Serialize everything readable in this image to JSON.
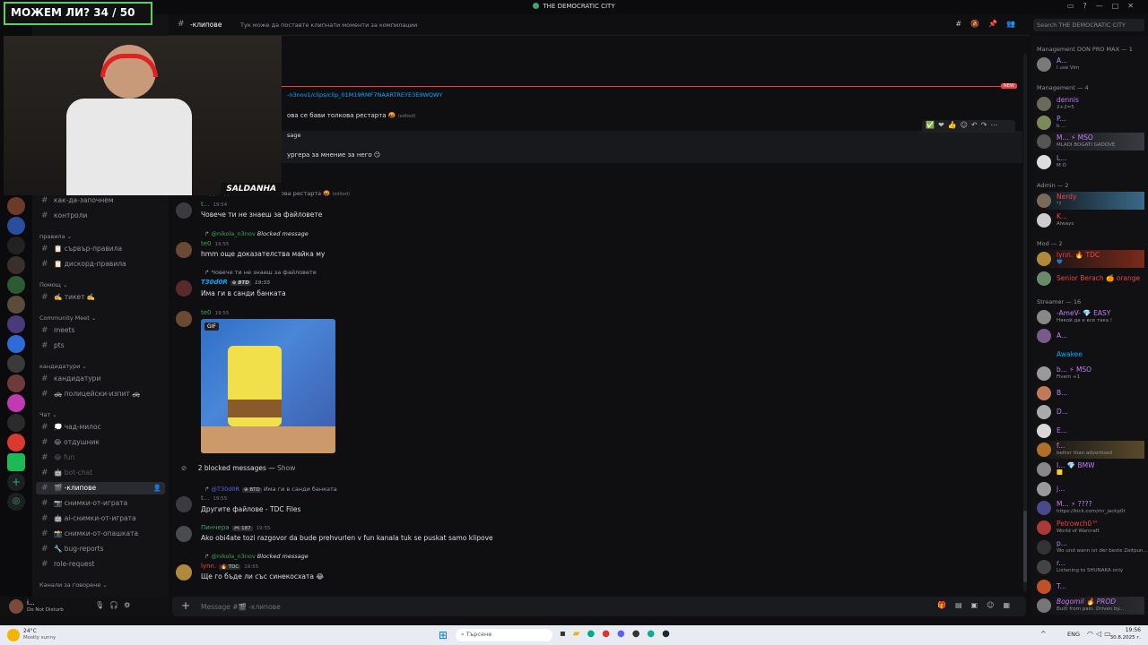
{
  "window": {
    "title": "THE DEMOCRATIC CITY",
    "controls": [
      "▭",
      "?",
      "—",
      "□",
      "✕"
    ]
  },
  "overlay": {
    "counter_text": "МОЖЕМ ЛИ? 34 / 50",
    "streamer_name": "SALDANHA"
  },
  "channel_header": {
    "name": "-клипове",
    "topic": "Тук може да поставте клипнати моменти за компилации",
    "search_placeholder": "Search THE DEMOCRATIC CITY"
  },
  "sidebar": {
    "channels_top": [
      "как-да-започнем",
      "контроли"
    ],
    "categories": [
      {
        "name": "правила",
        "channels": [
          "📋 сървър-правила",
          "📋 дискорд-правила"
        ]
      },
      {
        "name": "Помощ",
        "channels": [
          "✍️ тикет ✍️"
        ]
      },
      {
        "name": "Community Meet",
        "channels": [
          "meets",
          "pts"
        ]
      },
      {
        "name": "кандидатури",
        "channels": [
          "кандидатури",
          "🚓 полицейски-изпит 🚓"
        ]
      },
      {
        "name": "Чат",
        "channels": [
          "💭 чад-милос",
          "😂 отдушник",
          "😂 fun",
          "🤖 bot-chat",
          "🎬 -клипове",
          "📷 снимки-от-играта",
          "🤖 ai-снимки-от-играта",
          "📸 снимки-от-опашката",
          "🔧 bug-reports",
          "role-request"
        ]
      },
      {
        "name": "Канали за говорене",
        "channels": []
      }
    ],
    "active_channel": "🎬 -клипове",
    "muted_channels": [
      "😂 fun",
      "🤖 bot-chat"
    ]
  },
  "user_panel": {
    "name": "i...",
    "status": "Do Not Disturb"
  },
  "messages": {
    "top_partial": [
      {
        "text": "-n3nov1/clips/clip_01M19RMF7NAARTREYE3E9WQWY"
      },
      {
        "text": "ова се бави толкова рестарта 🤬",
        "edited": "(edited)"
      },
      {
        "text": "sage"
      },
      {
        "text": "ургера за мнение за него 😏"
      }
    ],
    "new_label": "NEW",
    "list": [
      {
        "reply": "...дизадали се бави толкова рестарта 🤬",
        "reply_edited": "(edited)",
        "author": "t...",
        "time": "19:54",
        "text": "Човече ти не знаеш за файловете",
        "color": "#3ba55c"
      },
      {
        "reply_user": "@nikola_n3nov",
        "reply_text": "Blocked message",
        "author": "te0",
        "time": "19:55",
        "text": "hmm още доказателства майка му",
        "color": "#3ba55c"
      },
      {
        "reply": "Човече ти не знаеш за файловете",
        "author": "T30d0R",
        "badge": "⊕ BTD",
        "time": "19:55",
        "text": "Има ги в санди банката",
        "color": "#5865f2"
      },
      {
        "author": "te0",
        "time": "19:55",
        "gif": "GIF",
        "color": "#3ba55c"
      },
      {
        "blocked": "2 blocked messages —",
        "show": "Show"
      },
      {
        "reply_user": "@T30d0R",
        "reply_badge": "⊕ BTD",
        "reply_text": "Има ги в санди банката",
        "author": "t...",
        "time": "19:55",
        "text": "Другите файлове - TDC Files",
        "color": "#3ba55c"
      },
      {
        "author": "Пинчера",
        "badge": "🎮 187",
        "time": "19:55",
        "text": "Ako obi4ate tozi razgovor da bude prehvurlen v fun kanala tuk se puskat samo klipove",
        "color": "#3ba55c"
      },
      {
        "reply_user": "@nikola_n3nov",
        "reply_text": "Blocked message",
        "author": "lynn.",
        "badge": "🔥 TDC",
        "time": "19:55",
        "text": "Ще го бъде ли със синекосхата 😂",
        "color": "#ed4245"
      }
    ]
  },
  "composer": {
    "placeholder": "Message #🎬 -клипове"
  },
  "members": {
    "groups": [
      {
        "title": "Management DON PRO MAX — 1",
        "members": [
          {
            "name": "A...",
            "status": "I use Vim",
            "color": "#c27cf7"
          }
        ]
      },
      {
        "title": "Management — 4",
        "members": [
          {
            "name": "dennis",
            "status": "2+2=5",
            "color": "#c27cf7"
          },
          {
            "name": "P...",
            "status": "b ...",
            "color": "#c27cf7"
          },
          {
            "name": "M... ⚡ MSO",
            "status": "MLADI BOGATI GADOVE",
            "color": "#c27cf7"
          },
          {
            "name": "L...",
            "status": "М О",
            "color": "#c27cf7"
          }
        ]
      },
      {
        "title": "Admin — 2",
        "members": [
          {
            "name": "Nerdy",
            "status": "\"?",
            "color": "#ed4245"
          },
          {
            "name": "K...",
            "status": "Always",
            "color": "#ed4245"
          }
        ]
      },
      {
        "title": "Mod — 2",
        "members": [
          {
            "name": "lynn. 🔥 TDC",
            "status": "💙",
            "color": "#ed4245"
          },
          {
            "name": "Senior Berach 🍊 orange",
            "status": "",
            "color": "#ed4245"
          }
        ]
      },
      {
        "title": "Streamer — 16",
        "members": [
          {
            "name": "-AmeV- 💎 EASY",
            "status": "Някой да е все така !",
            "color": "#c27cf7"
          },
          {
            "name": "A...",
            "status": "",
            "color": "#c27cf7"
          },
          {
            "name": "Awakee",
            "status": "",
            "color": "#5865f2"
          },
          {
            "name": "b... ⚡ MSO",
            "status": "Fivem +1",
            "color": "#c27cf7"
          },
          {
            "name": "B...",
            "status": "",
            "color": "#c27cf7"
          },
          {
            "name": "D...",
            "status": "",
            "color": "#c27cf7"
          },
          {
            "name": "E...",
            "status": "",
            "color": "#c27cf7"
          },
          {
            "name": "f...",
            "status": "better than advertised",
            "color": "#c27cf7"
          },
          {
            "name": "I... 💎 BMW",
            "status": "🟨",
            "color": "#c27cf7"
          },
          {
            "name": "j...",
            "status": "",
            "color": "#c27cf7"
          },
          {
            "name": "M... ⚡ ????",
            "status": "https://kick.com/mr_jackp0t",
            "color": "#c27cf7"
          },
          {
            "name": "Petrowch0™",
            "status": "World of Warcraft",
            "color": "#ed4245"
          },
          {
            "name": "p...",
            "status": "Wo und wann ist der beste Zeitpun...",
            "color": "#c27cf7"
          },
          {
            "name": "r...",
            "status": "Listening to SHUNAKA only",
            "color": "#c27cf7"
          },
          {
            "name": "T...",
            "status": "",
            "color": "#c27cf7"
          },
          {
            "name": "Bogomil 🔥 PROD",
            "status": "Built from pain. Driven by...",
            "color": "#c27cf7"
          }
        ]
      }
    ]
  },
  "taskbar": {
    "weather_temp": "24°C",
    "weather_desc": "Mostly sunny",
    "search_placeholder": "Търсене",
    "lang": "ENG",
    "time": "19:56",
    "date": "30.8.2025 г."
  },
  "colors": {
    "accent": "#5865f2",
    "bg": "#0f0f12",
    "green": "#3ba55c",
    "red": "#ed4245"
  }
}
